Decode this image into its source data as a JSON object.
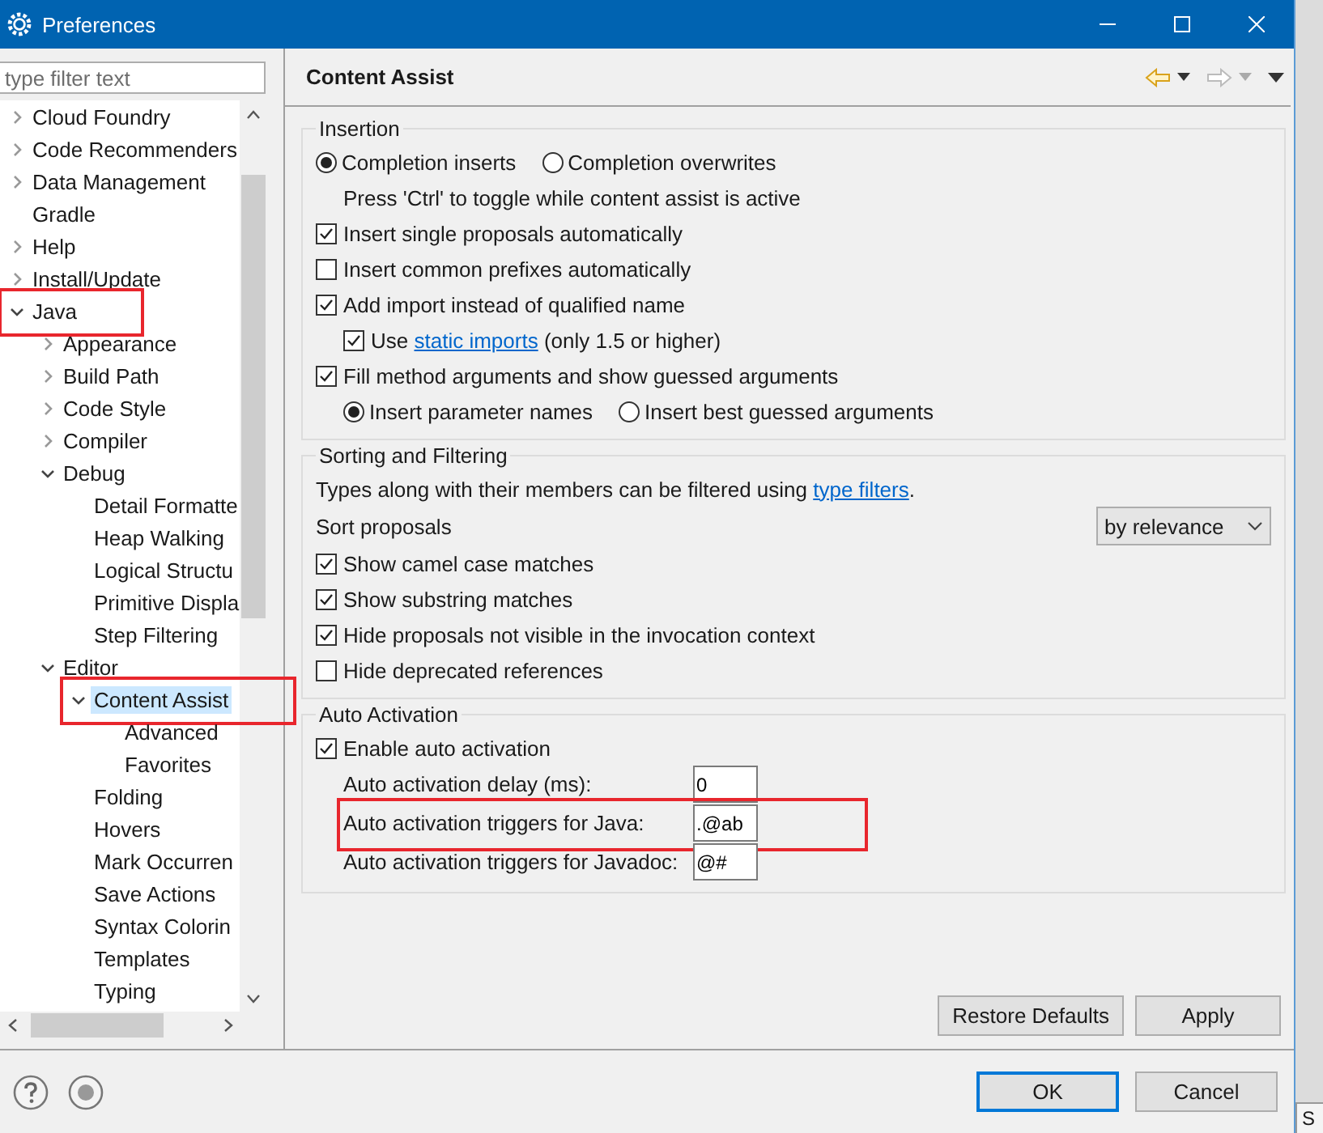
{
  "window": {
    "title": "Preferences"
  },
  "filter": {
    "placeholder": "type filter text"
  },
  "tree": [
    {
      "label": "Cloud Foundry",
      "expanded": false,
      "selected": false
    },
    {
      "label": "Code Recommenders",
      "expanded": false,
      "selected": false
    },
    {
      "label": "Data Management",
      "expanded": false,
      "selected": false
    },
    {
      "label": "Gradle",
      "selected": false
    },
    {
      "label": "Help",
      "expanded": false,
      "selected": false
    },
    {
      "label": "Install/Update",
      "expanded": false,
      "selected": false
    },
    {
      "label": "Java",
      "expanded": true,
      "selected": false,
      "annotated": true,
      "children": [
        {
          "label": "Appearance",
          "expanded": false,
          "selected": false
        },
        {
          "label": "Build Path",
          "expanded": false,
          "selected": false
        },
        {
          "label": "Code Style",
          "expanded": false,
          "selected": false
        },
        {
          "label": "Compiler",
          "expanded": false,
          "selected": false
        },
        {
          "label": "Debug",
          "expanded": true,
          "selected": false,
          "children": [
            {
              "label": "Detail Formatte",
              "selected": false
            },
            {
              "label": "Heap Walking",
              "selected": false
            },
            {
              "label": "Logical Structu",
              "selected": false
            },
            {
              "label": "Primitive Displa",
              "selected": false
            },
            {
              "label": "Step Filtering",
              "selected": false
            }
          ]
        },
        {
          "label": "Editor",
          "expanded": true,
          "selected": false,
          "children": [
            {
              "label": "Content Assist",
              "expanded": true,
              "selected": true,
              "annotated": true,
              "children": [
                {
                  "label": "Advanced",
                  "selected": false
                },
                {
                  "label": "Favorites",
                  "selected": false
                }
              ]
            },
            {
              "label": "Folding",
              "selected": false
            },
            {
              "label": "Hovers",
              "selected": false
            },
            {
              "label": "Mark Occurren",
              "selected": false
            },
            {
              "label": "Save Actions",
              "selected": false
            },
            {
              "label": "Syntax Colorin",
              "selected": false
            },
            {
              "label": "Templates",
              "selected": false
            },
            {
              "label": "Typing",
              "selected": false
            }
          ]
        }
      ]
    }
  ],
  "page": {
    "title": "Content Assist"
  },
  "groups": [
    {
      "title": "Insertion",
      "rows": [
        {
          "kind": "radios",
          "options": [
            {
              "label": "Completion inserts",
              "selected": true
            },
            {
              "label": "Completion overwrites",
              "selected": false
            }
          ],
          "children": [
            {
              "kind": "note",
              "text": "Press 'Ctrl' to toggle while content assist is active"
            }
          ]
        },
        {
          "kind": "checkbox",
          "label": "Insert single proposals automatically",
          "checked": true
        },
        {
          "kind": "checkbox",
          "label": "Insert common prefixes automatically",
          "checked": false
        },
        {
          "kind": "checkbox",
          "label": "Add import instead of qualified name",
          "checked": true,
          "children": [
            {
              "kind": "checkbox",
              "label": "Use",
              "link": "static imports",
              "suffix": " (only 1.5 or higher)",
              "checked": true
            }
          ]
        },
        {
          "kind": "checkbox",
          "label": "Fill method arguments and show guessed arguments",
          "checked": true,
          "children": [
            {
              "kind": "radios",
              "options": [
                {
                  "label": "Insert parameter names",
                  "selected": true
                },
                {
                  "label": "Insert best guessed arguments",
                  "selected": false
                }
              ]
            }
          ]
        }
      ]
    },
    {
      "title": "Sorting and Filtering",
      "rows": [
        {
          "kind": "note",
          "text": "Types along with their members can be filtered using",
          "link": "type filters",
          "suffix": "."
        },
        {
          "kind": "select",
          "label": "Sort proposals",
          "value": "by relevance"
        },
        {
          "kind": "checkbox",
          "label": "Show camel case matches",
          "checked": true
        },
        {
          "kind": "checkbox",
          "label": "Show substring matches",
          "checked": true
        },
        {
          "kind": "checkbox",
          "label": "Hide proposals not visible in the invocation context",
          "checked": true
        },
        {
          "kind": "checkbox",
          "label": "Hide deprecated references",
          "checked": false
        }
      ]
    },
    {
      "title": "Auto Activation",
      "rows": [
        {
          "kind": "checkbox",
          "label": "Enable auto activation",
          "checked": true,
          "children": [
            {
              "kind": "field",
              "label": "Auto activation delay (ms):",
              "value": "0"
            },
            {
              "kind": "field",
              "label": "Auto activation triggers for Java:",
              "value": ".@ab",
              "annotated": true
            },
            {
              "kind": "field",
              "label": "Auto activation triggers for Javadoc:",
              "value": "@#"
            }
          ]
        }
      ]
    }
  ],
  "page_buttons": [
    "Restore Defaults",
    "Apply"
  ],
  "dialog_buttons": [
    {
      "label": "OK",
      "default": true
    },
    {
      "label": "Cancel",
      "default": false
    }
  ],
  "background": {
    "text": "S"
  }
}
